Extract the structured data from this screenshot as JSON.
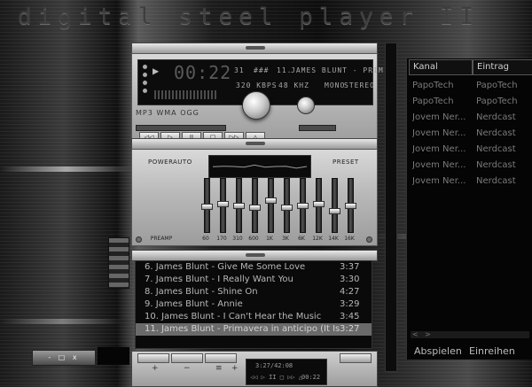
{
  "skin_title": "digital steel player II",
  "display": {
    "play_symbol": "▶",
    "time": "00:22",
    "track_number": "11.",
    "now_playing": "JAMES BLUNT - PRIM",
    "bitrate": "320 KBPS",
    "samplerate": "48 KHZ",
    "mono": "MONO",
    "stereo": "STEREO",
    "counter_a": "31",
    "counter_b": "###",
    "codecs": "MP3 WMA OGG"
  },
  "transport": [
    "◁◁",
    "▷",
    "II",
    "□",
    "▷▷",
    "△"
  ],
  "equalizer": {
    "power_label": "POWER",
    "auto_label": "AUTO",
    "preset_label": "PRESET",
    "preamp_label": "PREAMP",
    "preamp_level": 0.55,
    "bands": [
      {
        "freq": "60",
        "level": 0.52
      },
      {
        "freq": "170",
        "level": 0.48
      },
      {
        "freq": "310",
        "level": 0.5
      },
      {
        "freq": "600",
        "level": 0.55
      },
      {
        "freq": "1K",
        "level": 0.4
      },
      {
        "freq": "3K",
        "level": 0.55
      },
      {
        "freq": "6K",
        "level": 0.5
      },
      {
        "freq": "12K",
        "level": 0.48
      },
      {
        "freq": "14K",
        "level": 0.62
      },
      {
        "freq": "16K",
        "level": 0.5
      }
    ]
  },
  "playlist": {
    "items": [
      {
        "name": "6. James Blunt - Give Me Some Love",
        "duration": "3:37",
        "selected": false
      },
      {
        "name": "7. James Blunt - I Really Want You",
        "duration": "3:30",
        "selected": false
      },
      {
        "name": "8. James Blunt - Shine On",
        "duration": "4:27",
        "selected": false
      },
      {
        "name": "9. James Blunt - Annie",
        "duration": "3:29",
        "selected": false
      },
      {
        "name": "10. James Blunt - I Can't Hear the Music",
        "duration": "3:45",
        "selected": false
      },
      {
        "name": "11. James Blunt - Primavera in anticipo (It Is",
        "duration": "3:27",
        "selected": true
      }
    ],
    "ops": [
      "+",
      "−",
      "≡",
      "+"
    ],
    "mini_time": "3:27/42:08",
    "mini_pos": "00:22",
    "mini_controls": "◁◁ ▷ II □ ▷▷ △"
  },
  "browser": {
    "col1": "Kanal",
    "col2": "Eintrag",
    "rows": [
      {
        "kanal": "PapoTech",
        "eintrag": "PapoTech"
      },
      {
        "kanal": "PapoTech",
        "eintrag": "PapoTech"
      },
      {
        "kanal": "Jovem Ner...",
        "eintrag": "Nerdcast"
      },
      {
        "kanal": "Jovem Ner...",
        "eintrag": "Nerdcast"
      },
      {
        "kanal": "Jovem Ner...",
        "eintrag": "Nerdcast"
      },
      {
        "kanal": "Jovem Ner...",
        "eintrag": "Nerdcast"
      },
      {
        "kanal": "Jovem Ner...",
        "eintrag": "Nerdcast"
      }
    ],
    "scroll_left": "<",
    "scroll_right": ">",
    "play_button": "Abspielen",
    "subscribe_button": "Einreihen"
  },
  "minibar_label": "- □ x"
}
